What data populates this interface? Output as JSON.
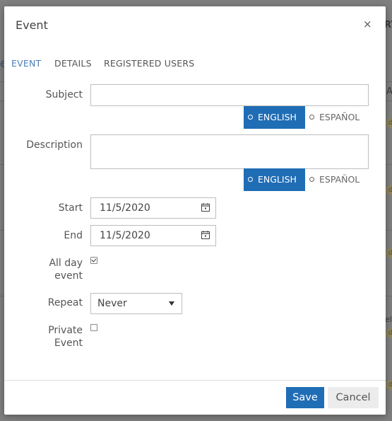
{
  "background": {
    "fragments": [
      "e",
      "RY",
      "A",
      "el"
    ]
  },
  "modal": {
    "title": "Event",
    "close_label": "×"
  },
  "tabs": [
    {
      "label": "EVENT",
      "active": true
    },
    {
      "label": "DETAILS",
      "active": false
    },
    {
      "label": "REGISTERED USERS",
      "active": false
    }
  ],
  "form": {
    "subject_label": "Subject",
    "subject_value": "",
    "description_label": "Description",
    "description_value": "",
    "languages": [
      "ENGLISH",
      "ESPAÑOL"
    ],
    "start_label": "Start",
    "start_value": "11/5/2020",
    "end_label": "End",
    "end_value": "11/5/2020",
    "all_day_label_line1": "All day",
    "all_day_label_line2": "event",
    "all_day_checked": true,
    "repeat_label": "Repeat",
    "repeat_value": "Never",
    "private_label_line1": "Private",
    "private_label_line2": "Event",
    "private_checked": false
  },
  "footer": {
    "save_label": "Save",
    "cancel_label": "Cancel"
  },
  "colors": {
    "accent": "#1f6db5",
    "tab_active": "#4a7db8"
  }
}
